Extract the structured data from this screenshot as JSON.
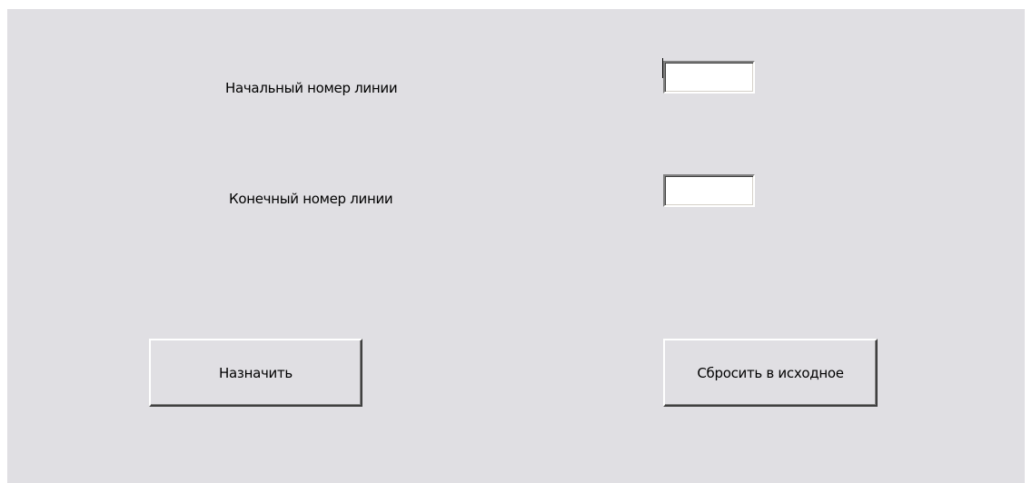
{
  "form": {
    "start_line_label": "Начальный номер линии",
    "start_line_value": "",
    "end_line_label": "Конечный номер линии",
    "end_line_value": "",
    "assign_button": "Назначить",
    "reset_button": "Сбросить в исходное"
  },
  "colors": {
    "dialog_background": "#e0dfe3",
    "field_background": "#ffffff",
    "text": "#000000"
  }
}
